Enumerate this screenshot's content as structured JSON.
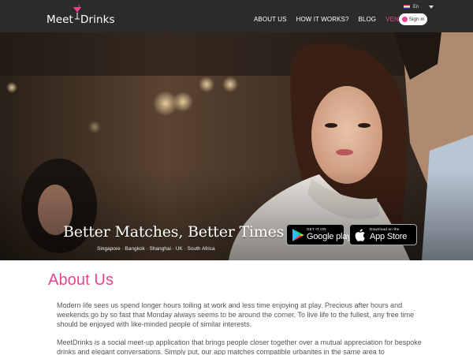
{
  "header": {
    "logo_left": "Meet",
    "logo_right": "Drinks",
    "nav": [
      {
        "label": "ABOUT US",
        "active": false
      },
      {
        "label": "HOW IT WORKS?",
        "active": false
      },
      {
        "label": "BLOG",
        "active": false
      },
      {
        "label": "VENUES",
        "active": true
      }
    ],
    "language": "En",
    "signin_label": "Sign in"
  },
  "hero": {
    "tagline": "Better Matches, Better Times",
    "cities": "Singapore · Bangkok · Shanghai · UK · South Africa",
    "google_play": {
      "small": "GET IT ON",
      "big": "Google play"
    },
    "app_store": {
      "small": "Download on the",
      "big": "App Store"
    }
  },
  "about": {
    "title": "About Us",
    "paragraph1": "Modern life sees us spend longer hours toiling at work and less time enjoying at play. Precious after hours and weekends go by so fast that Monday always seems to be around the corner. To live life to the fullest, any free time should be enjoyed with like-minded people of similar interests.",
    "paragraph2": "MeetDrinks is a social meet-up application that brings people closer together over a mutual appreciation for bespoke drinks and elegant conversations. Simply put, our app matches compatible urbanites in the same area to"
  },
  "colors": {
    "accent": "#e8438f",
    "header_bg": "#2b2b2b",
    "body_text": "#555555"
  }
}
